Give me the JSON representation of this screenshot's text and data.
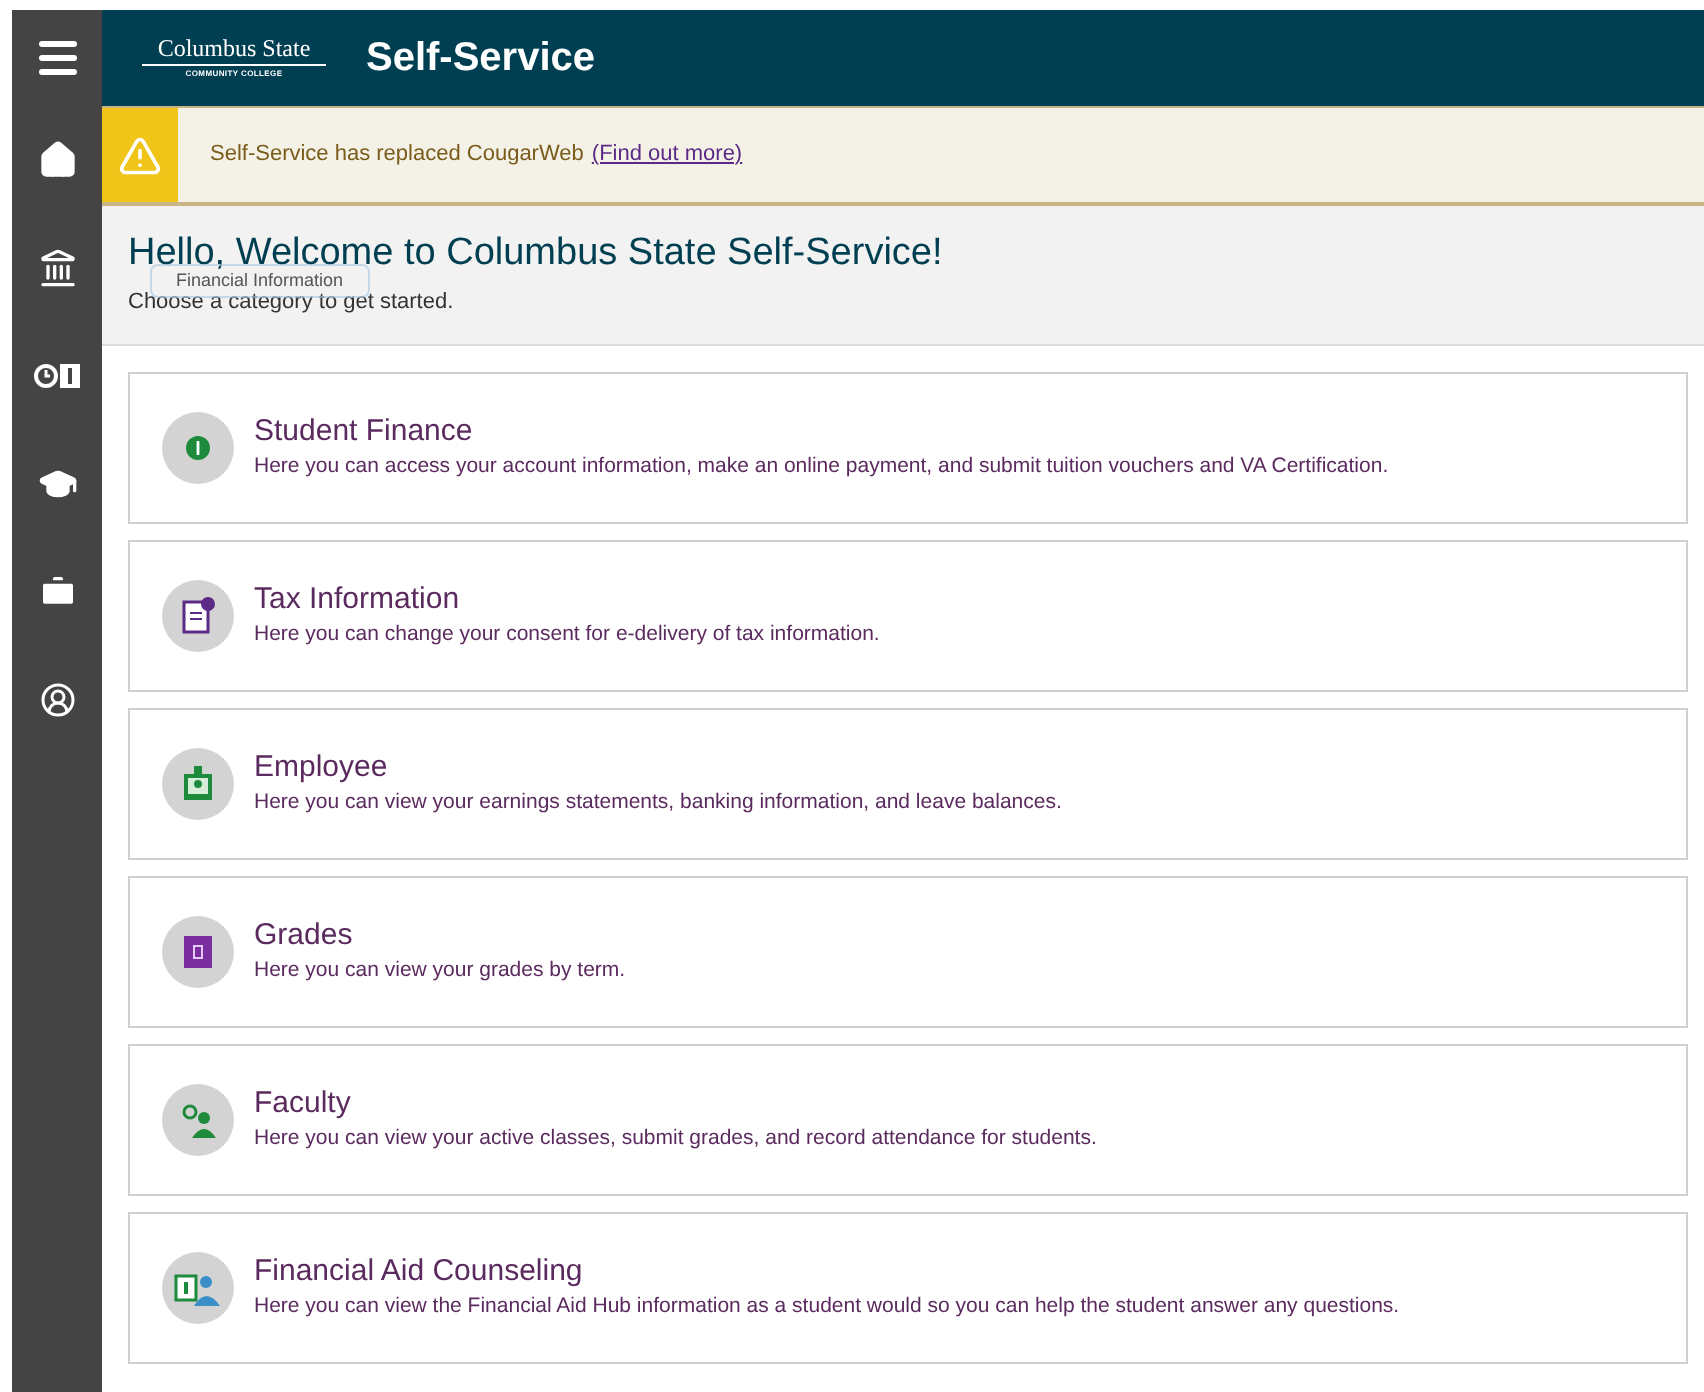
{
  "header": {
    "logo_line_1": "Columbus State",
    "logo_line_2": "COMMUNITY COLLEGE",
    "title": "Self-Service"
  },
  "banner": {
    "message": "Self-Service has replaced CougarWeb",
    "link": "(Find out more)"
  },
  "welcome": {
    "heading": "Hello, Welcome to Columbus State Self-Service!",
    "subtitle": "Choose a category to get started."
  },
  "tooltip": "Financial Information",
  "categories": [
    {
      "title": "Student Finance",
      "description": "Here you can access your account information, make an online payment, and submit tuition vouchers and VA Certification."
    },
    {
      "title": "Tax Information",
      "description": "Here you can change your consent for e-delivery of tax information."
    },
    {
      "title": "Employee",
      "description": "Here you can view your earnings statements, banking information, and leave balances."
    },
    {
      "title": "Grades",
      "description": "Here you can view your grades by term."
    },
    {
      "title": "Faculty",
      "description": "Here you can view your active classes, submit grades, and record attendance for students."
    },
    {
      "title": "Financial Aid Counseling",
      "description": "Here you can view the Financial Aid Hub information as a student would so you can help the student answer any questions."
    }
  ]
}
